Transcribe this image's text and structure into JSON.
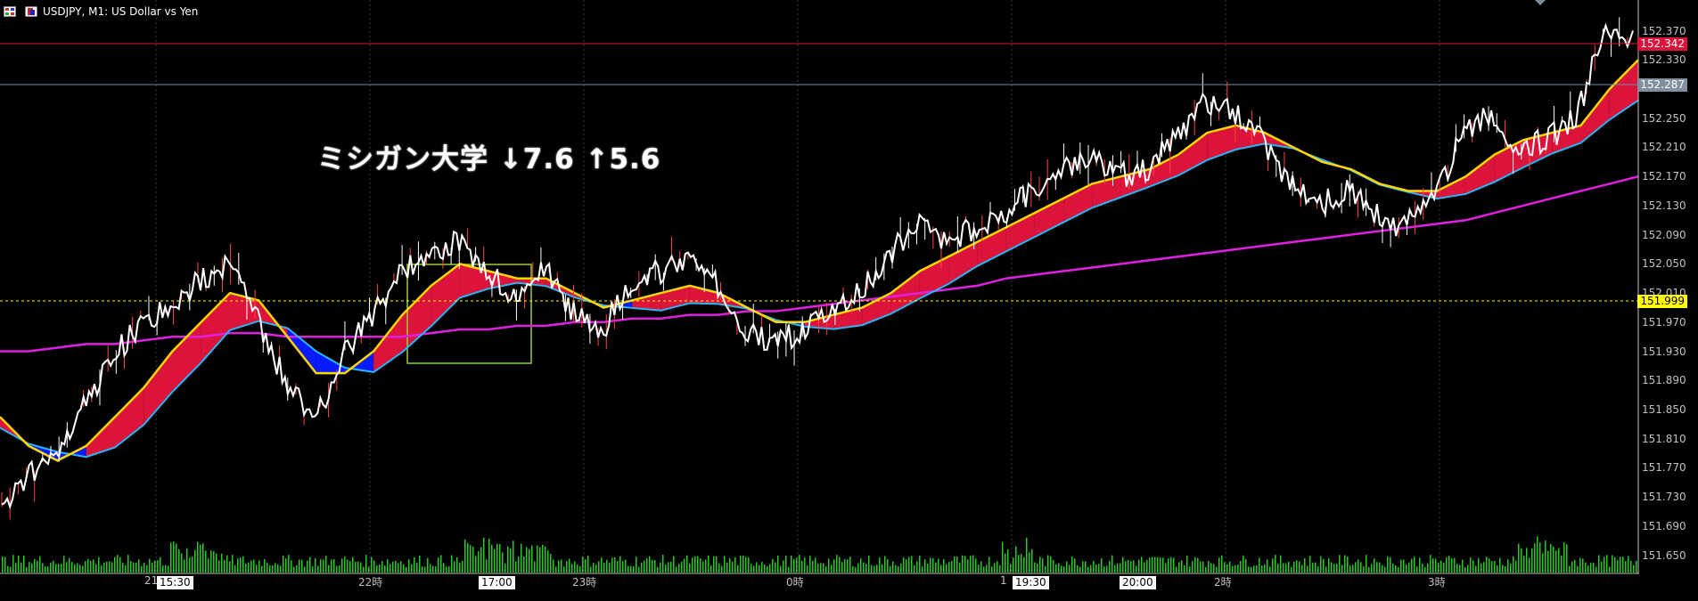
{
  "header": {
    "symbol_line": "USDJPY, M1:  US Dollar vs Yen",
    "icon_name": "chart-grid-icon"
  },
  "annotation": {
    "text": "ミシガン大学  ↓7.6  ↑5.6"
  },
  "price_axis": {
    "labels": [
      "152.370",
      "152.330",
      "152.250",
      "152.210",
      "152.170",
      "152.130",
      "152.090",
      "152.050",
      "152.010",
      "151.970",
      "151.930",
      "151.890",
      "151.850",
      "151.810",
      "151.770",
      "151.730",
      "151.690",
      "151.650"
    ]
  },
  "time_axis": {
    "labels": [
      "21",
      "22時",
      "23時",
      "0時",
      "1",
      "2時",
      "3時"
    ]
  },
  "price_tags": {
    "bid": {
      "text": "152.342",
      "color": "#dc143c"
    },
    "line2": {
      "text": "152.287",
      "color": "#8090a0"
    },
    "level": {
      "text": "151.999",
      "color": "#ffff00"
    }
  },
  "time_tags": [
    "15:30",
    "17:00",
    "19:30",
    "20:00"
  ],
  "colors": {
    "background": "#000000",
    "grid": "#3a3a3a",
    "candles": "#ffffff",
    "ema_fast": "#ffd700",
    "ema_mid": "#29b6f6",
    "ema_slow": "#e020e0",
    "cloud_up": "#dc143c",
    "cloud_down": "#0a1aff",
    "volume": "#22cc22",
    "box": "#9acd32"
  },
  "chart_data": {
    "type": "line",
    "title": "USDJPY, M1:  US Dollar vs Yen",
    "ylim": [
      151.63,
      152.4
    ],
    "x": [
      "21",
      "22時",
      "23時",
      "0時",
      "1",
      "2時",
      "3時"
    ],
    "series": [
      {
        "values": [
          151.72,
          151.76,
          151.8,
          151.86,
          151.93,
          151.97,
          152.0,
          152.03,
          152.05,
          151.97,
          151.88,
          151.84,
          151.93,
          151.98,
          152.04,
          152.07,
          152.08,
          152.04,
          152.0,
          152.05,
          151.98,
          151.96,
          152.03,
          152.04,
          152.05,
          152.02,
          151.96,
          151.94,
          151.96,
          151.99,
          152.01,
          152.06,
          152.11,
          152.08,
          152.1,
          152.12,
          152.15,
          152.18,
          152.2,
          152.17,
          152.18,
          152.22,
          152.27,
          152.26,
          152.22,
          152.16,
          152.13,
          152.15,
          152.12,
          152.1,
          152.14,
          152.22,
          152.26,
          152.21,
          152.22,
          152.25,
          152.37,
          152.36
        ]
      },
      {
        "values": [
          151.84,
          151.8,
          151.78,
          151.8,
          151.84,
          151.88,
          151.93,
          151.97,
          152.01,
          152.0,
          151.95,
          151.9,
          151.9,
          151.93,
          151.98,
          152.02,
          152.05,
          152.04,
          152.03,
          152.03,
          152.01,
          151.99,
          152.0,
          152.01,
          152.02,
          152.01,
          151.99,
          151.97,
          151.97,
          151.98,
          151.99,
          152.01,
          152.04,
          152.06,
          152.08,
          152.1,
          152.12,
          152.14,
          152.16,
          152.17,
          152.18,
          152.2,
          152.23,
          152.24,
          152.23,
          152.21,
          152.19,
          152.18,
          152.16,
          152.15,
          152.15,
          152.17,
          152.2,
          152.22,
          152.23,
          152.24,
          152.29,
          152.33
        ]
      },
      {
        "values": [
          151.93,
          151.93,
          151.935,
          151.94,
          151.94,
          151.945,
          151.95,
          151.95,
          151.955,
          151.955,
          151.95,
          151.95,
          151.95,
          151.95,
          151.95,
          151.955,
          151.96,
          151.96,
          151.965,
          151.965,
          151.97,
          151.97,
          151.975,
          151.975,
          151.98,
          151.98,
          151.985,
          151.985,
          151.99,
          151.995,
          152.0,
          152.005,
          152.01,
          152.015,
          152.02,
          152.03,
          152.035,
          152.04,
          152.045,
          152.05,
          152.055,
          152.06,
          152.065,
          152.07,
          152.075,
          152.08,
          152.085,
          152.09,
          152.095,
          152.1,
          152.105,
          152.11,
          152.12,
          152.13,
          152.14,
          152.15,
          152.16,
          152.17
        ]
      }
    ]
  }
}
